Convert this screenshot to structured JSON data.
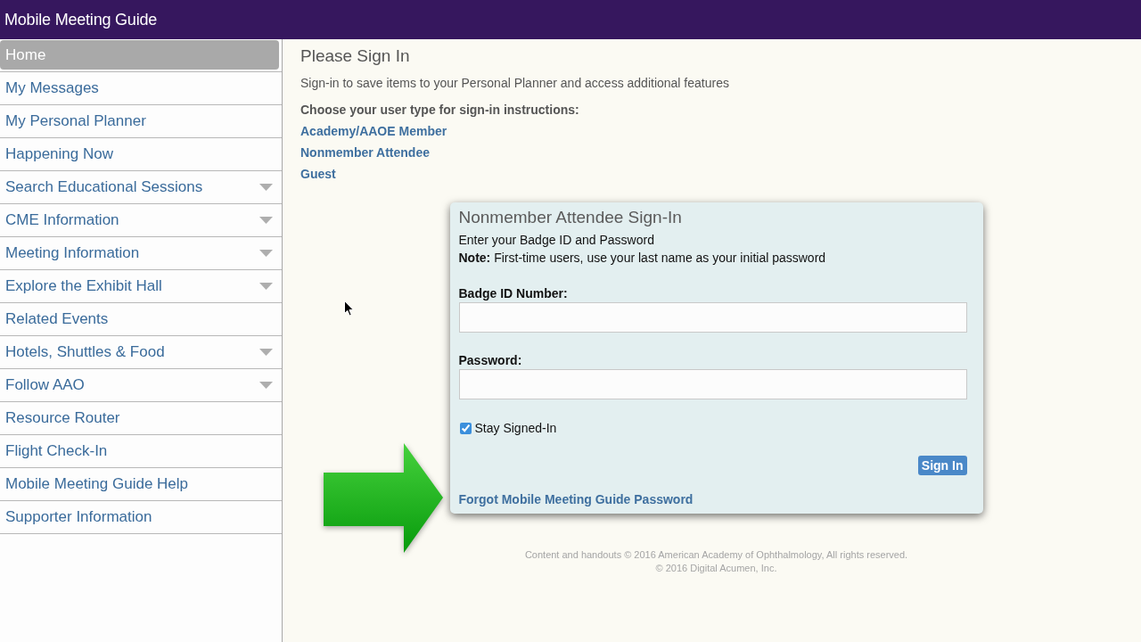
{
  "header": {
    "title": "Mobile Meeting Guide"
  },
  "sidebar": {
    "items": [
      {
        "label": "Home",
        "selected": true,
        "expandable": false
      },
      {
        "label": "My Messages",
        "selected": false,
        "expandable": false
      },
      {
        "label": "My Personal Planner",
        "selected": false,
        "expandable": false
      },
      {
        "label": "Happening Now",
        "selected": false,
        "expandable": false
      },
      {
        "label": "Search Educational Sessions",
        "selected": false,
        "expandable": true
      },
      {
        "label": "CME Information",
        "selected": false,
        "expandable": true
      },
      {
        "label": "Meeting Information",
        "selected": false,
        "expandable": true
      },
      {
        "label": "Explore the Exhibit Hall",
        "selected": false,
        "expandable": true
      },
      {
        "label": "Related Events",
        "selected": false,
        "expandable": false
      },
      {
        "label": "Hotels, Shuttles & Food",
        "selected": false,
        "expandable": true
      },
      {
        "label": "Follow AAO",
        "selected": false,
        "expandable": true
      },
      {
        "label": "Resource Router",
        "selected": false,
        "expandable": false
      },
      {
        "label": "Flight Check-In",
        "selected": false,
        "expandable": false
      },
      {
        "label": "Mobile Meeting Guide Help",
        "selected": false,
        "expandable": false
      },
      {
        "label": "Supporter Information",
        "selected": false,
        "expandable": false
      }
    ]
  },
  "main": {
    "heading": "Please Sign In",
    "description": "Sign-in to save items to your Personal Planner and access additional features",
    "prompt": "Choose your user type for sign-in instructions:",
    "user_types": [
      "Academy/AAOE Member",
      "Nonmember Attendee",
      "Guest"
    ]
  },
  "dialog": {
    "title": "Nonmember Attendee Sign-In",
    "instructions": "Enter your Badge ID and Password",
    "note": "**Note:** First-time users, use your last name as your initial password",
    "fields": [
      {
        "label": "Badge ID Number:"
      },
      {
        "label": "Password:"
      }
    ],
    "stay_signed_in": {
      "label": "Stay Signed-In",
      "checked": true
    },
    "submit": "Sign In",
    "forgot_link": "Forgot Mobile Meeting Guide Password"
  },
  "footer": {
    "lines": [
      "Content and handouts © 2016 American Academy of Ophthalmology, All rights reserved.",
      "© 2016 Digital Acumen, Inc."
    ]
  }
}
